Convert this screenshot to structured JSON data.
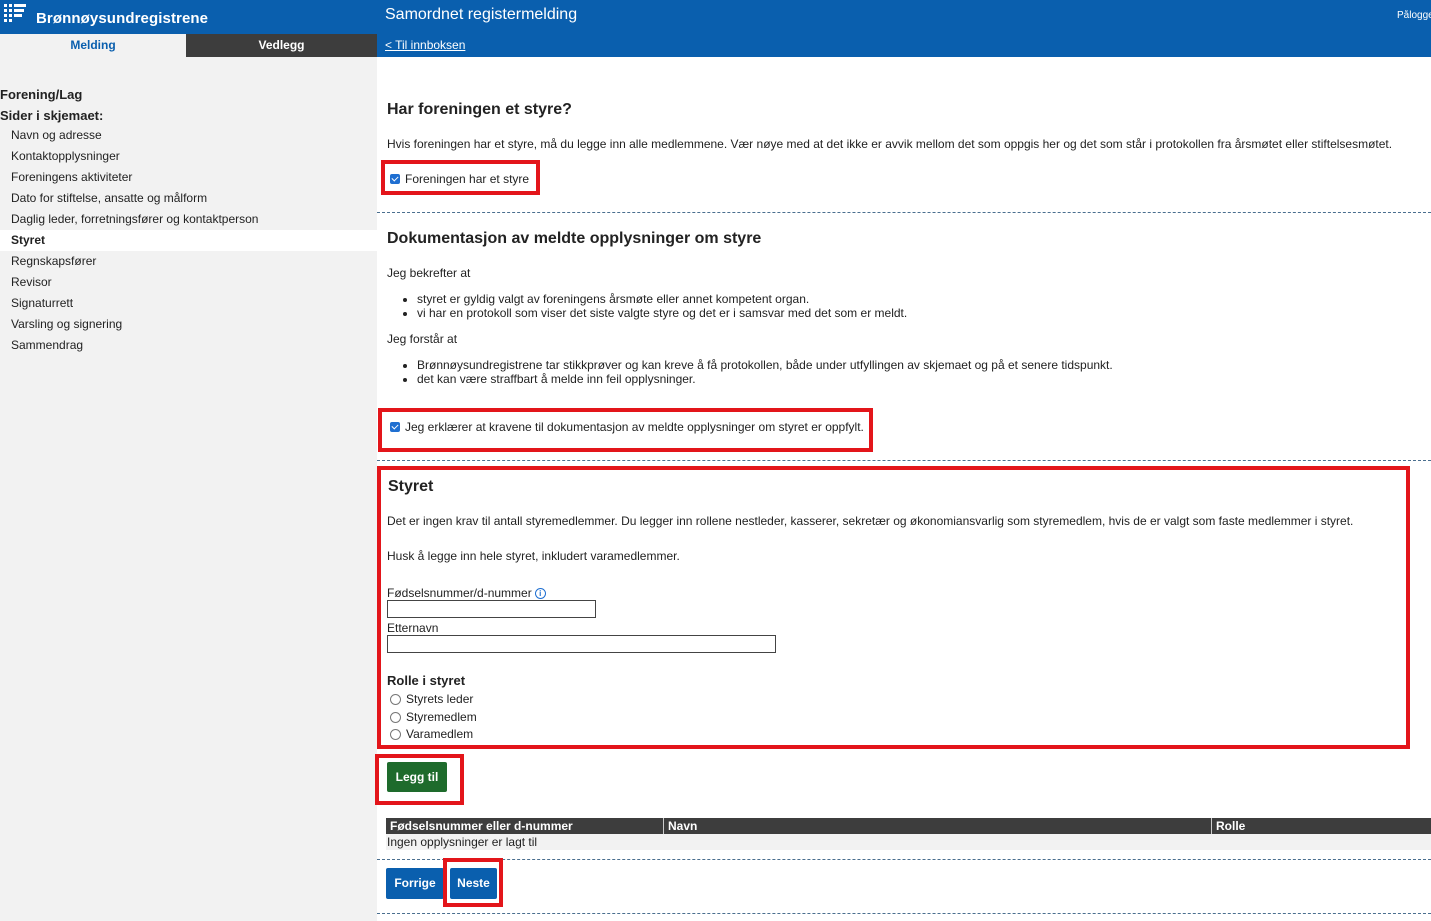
{
  "header": {
    "brand": "Brønnøysundregistrene",
    "app_title": "Samordnet registermelding",
    "login": "Pålogget",
    "back_link": "< Til innboksen"
  },
  "tabs": {
    "melding": "Melding",
    "vedlegg": "Vedlegg"
  },
  "sidebar": {
    "form_type": "Forening/Lag",
    "pages_heading": "Sider i skjemaet:",
    "items": [
      {
        "label": "Navn og adresse"
      },
      {
        "label": "Kontaktopplysninger"
      },
      {
        "label": "Foreningens aktiviteter"
      },
      {
        "label": "Dato for stiftelse, ansatte og målform"
      },
      {
        "label": "Daglig leder, forretningsfører og kontaktperson"
      },
      {
        "label": "Styret"
      },
      {
        "label": "Regnskapsfører"
      },
      {
        "label": "Revisor"
      },
      {
        "label": "Signaturrett"
      },
      {
        "label": "Varsling og signering"
      },
      {
        "label": "Sammendrag"
      }
    ],
    "active_item": "Styret"
  },
  "board_question": {
    "title": "Har foreningen et styre?",
    "description": "Hvis foreningen har et styre, må du legge inn alle medlemmene. Vær nøye med at det ikke er avvik mellom det som oppgis her og det som står i protokollen fra årsmøtet eller stiftelsesmøtet.",
    "checkbox_label": "Foreningen har et styre",
    "checked": true
  },
  "documentation": {
    "title": "Dokumentasjon av meldte opplysninger om styre",
    "confirm_intro": "Jeg bekrefter at",
    "confirm_items": [
      "styret er gyldig valgt av foreningens årsmøte eller annet kompetent organ.",
      "vi har en protokoll som viser det siste valgte styre og det er i samsvar med det som er meldt."
    ],
    "understand_intro": "Jeg forstår at",
    "understand_items": [
      "Brønnøysundregistrene tar stikkprøver og kan kreve å få protokollen, både under utfyllingen av skjemaet og på et senere tidspunkt.",
      "det kan være straffbart å melde inn feil opplysninger."
    ],
    "declaration_label": "Jeg erklærer at kravene til dokumentasjon av meldte opplysninger om styret er oppfylt.",
    "checked": true
  },
  "board": {
    "title": "Styret",
    "description1": "Det er ingen krav til antall styremedlemmer. Du legger inn rollene nestleder, kasserer, sekretær og økonomiansvarlig som styremedlem, hvis de er valgt som faste medlemmer i styret.",
    "description2": "Husk å legge inn hele styret, inkludert varamedlemmer.",
    "fnr_label": "Fødselsnummer/d-nummer",
    "fnr_value": "",
    "surname_label": "Etternavn",
    "surname_value": "",
    "role_heading": "Rolle i styret",
    "roles": [
      "Styrets leder",
      "Styremedlem",
      "Varamedlem"
    ],
    "add_button": "Legg til"
  },
  "table": {
    "columns": [
      "Fødselsnummer eller d-nummer",
      "Navn",
      "Rolle"
    ],
    "empty_text": "Ingen opplysninger er lagt til"
  },
  "nav": {
    "previous": "Forrige",
    "next": "Neste"
  },
  "colors": {
    "header_blue": "#0a5fae",
    "highlight_red": "#e3151a",
    "button_green": "#1e6b2c"
  }
}
